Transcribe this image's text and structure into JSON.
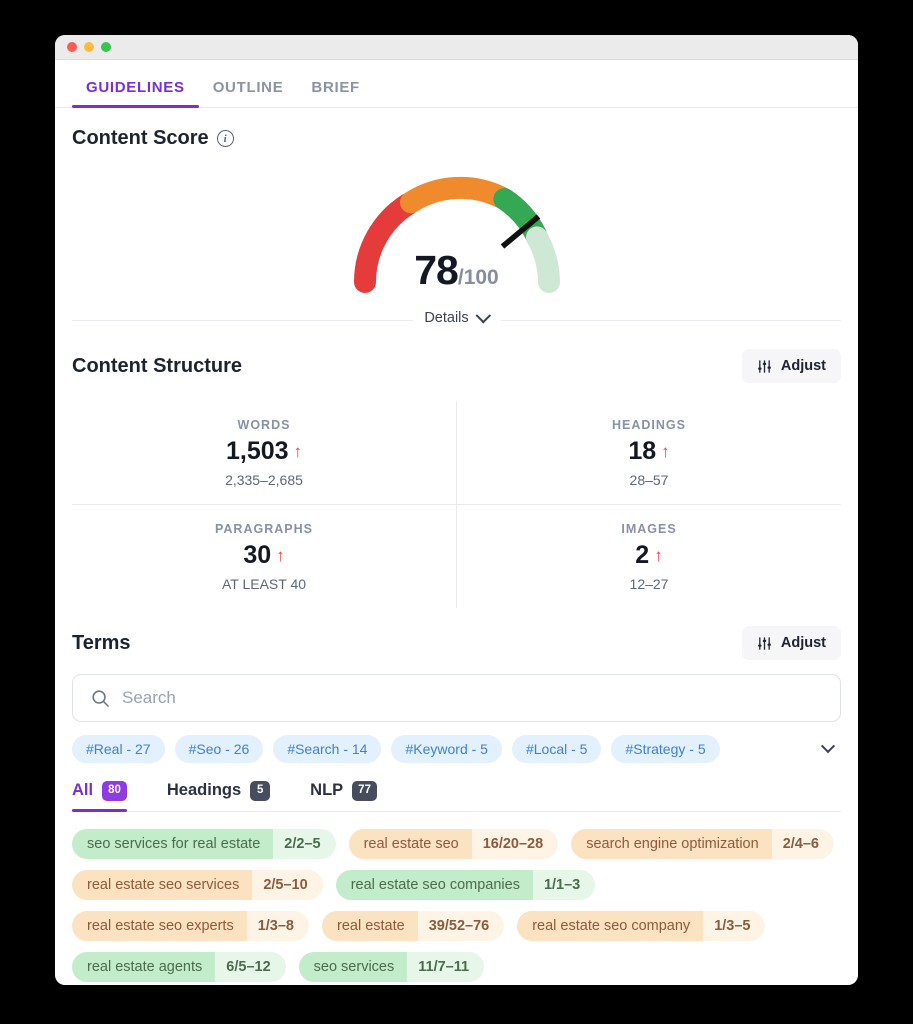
{
  "window": {
    "traffic_lights": [
      "close",
      "minimize",
      "zoom"
    ]
  },
  "topnav": {
    "tabs": [
      {
        "label": "GUIDELINES",
        "active": true
      },
      {
        "label": "OUTLINE",
        "active": false
      },
      {
        "label": "BRIEF",
        "active": false
      }
    ],
    "accent_color": "#7a2fd4"
  },
  "content_score": {
    "title": "Content Score",
    "info_glyph": "i",
    "value": "78",
    "max": "/100",
    "details_label": "Details"
  },
  "chart_data": {
    "type": "gauge",
    "title": "Content Score",
    "value": 78,
    "min": 0,
    "max": 100,
    "segments": [
      {
        "name": "poor",
        "from": 0,
        "to": 33,
        "color": "#e53b3b"
      },
      {
        "name": "average",
        "from": 33,
        "to": 66,
        "color": "#ef8b2c"
      },
      {
        "name": "good",
        "from": 66,
        "to": 82,
        "color": "#35a853"
      },
      {
        "name": "remaining",
        "from": 82,
        "to": 100,
        "color": "#cfe8d5"
      }
    ],
    "needle_value": 78,
    "needle_color": "#111111",
    "label": "78/100"
  },
  "content_structure": {
    "title": "Content Structure",
    "adjust_label": "Adjust",
    "adjust_icon": "sliders-icon",
    "stats": [
      {
        "label": "WORDS",
        "value": "1,503",
        "trend": "↑",
        "range": "2,335–2,685"
      },
      {
        "label": "HEADINGS",
        "value": "18",
        "trend": "↑",
        "range": "28–57"
      },
      {
        "label": "PARAGRAPHS",
        "value": "30",
        "trend": "↑",
        "range": "AT LEAST 40"
      },
      {
        "label": "IMAGES",
        "value": "2",
        "trend": "↑",
        "range": "12–27"
      }
    ]
  },
  "terms": {
    "title": "Terms",
    "adjust_label": "Adjust",
    "search_placeholder": "Search",
    "search_value": "",
    "search_icon": "search-icon",
    "tags": [
      {
        "label": "#Real - 27"
      },
      {
        "label": "#Seo - 26"
      },
      {
        "label": "#Search - 14"
      },
      {
        "label": "#Keyword - 5"
      },
      {
        "label": "#Local - 5"
      },
      {
        "label": "#Strategy - 5"
      }
    ],
    "subtabs": [
      {
        "label": "All",
        "badge": "80",
        "active": true
      },
      {
        "label": "Headings",
        "badge": "5",
        "active": false
      },
      {
        "label": "NLP",
        "badge": "77",
        "active": false
      }
    ],
    "items": [
      {
        "name": "seo services for real estate",
        "count": "2/2–5",
        "tone": "green"
      },
      {
        "name": "real estate seo",
        "count": "16/20–28",
        "tone": "orange"
      },
      {
        "name": "search engine optimization",
        "count": "2/4–6",
        "tone": "orange"
      },
      {
        "name": "real estate seo services",
        "count": "2/5–10",
        "tone": "orange"
      },
      {
        "name": "real estate seo companies",
        "count": "1/1–3",
        "tone": "green"
      },
      {
        "name": "real estate seo experts",
        "count": "1/3–8",
        "tone": "orange"
      },
      {
        "name": "real estate",
        "count": "39/52–76",
        "tone": "orange"
      },
      {
        "name": "real estate seo company",
        "count": "1/3–5",
        "tone": "orange"
      },
      {
        "name": "real estate agents",
        "count": "6/5–12",
        "tone": "green"
      },
      {
        "name": "seo services",
        "count": "11/7–11",
        "tone": "green"
      }
    ]
  }
}
